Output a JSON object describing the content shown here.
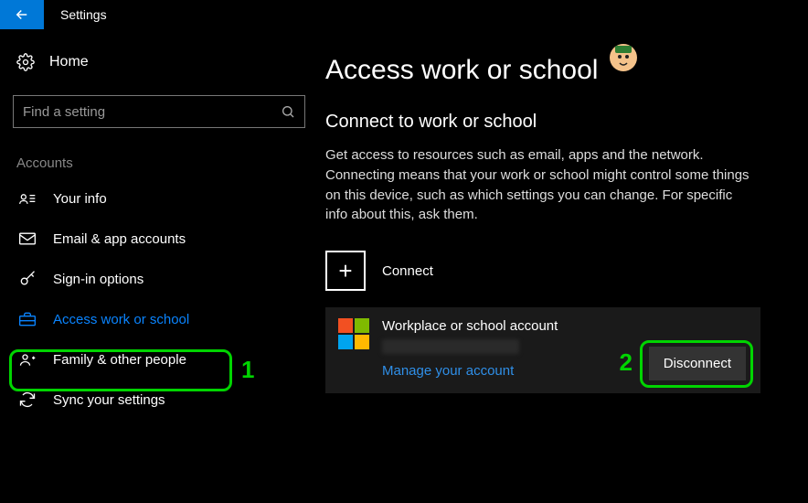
{
  "titlebar": {
    "title": "Settings"
  },
  "sidebar": {
    "home_label": "Home",
    "search_placeholder": "Find a setting",
    "section_label": "Accounts",
    "items": [
      {
        "label": "Your info"
      },
      {
        "label": "Email & app accounts"
      },
      {
        "label": "Sign-in options"
      },
      {
        "label": "Access work or school"
      },
      {
        "label": "Family & other people"
      },
      {
        "label": "Sync your settings"
      }
    ]
  },
  "main": {
    "page_title": "Access work or school",
    "sub_title": "Connect to work or school",
    "description": "Get access to resources such as email, apps and the network. Connecting means that your work or school might control some things on this device, such as which settings you can change. For specific info about this, ask them.",
    "connect_label": "Connect",
    "account": {
      "title": "Workplace or school account",
      "manage_link": "Manage your account",
      "disconnect_label": "Disconnect"
    }
  },
  "annotations": {
    "marker1": "1",
    "marker2": "2"
  }
}
